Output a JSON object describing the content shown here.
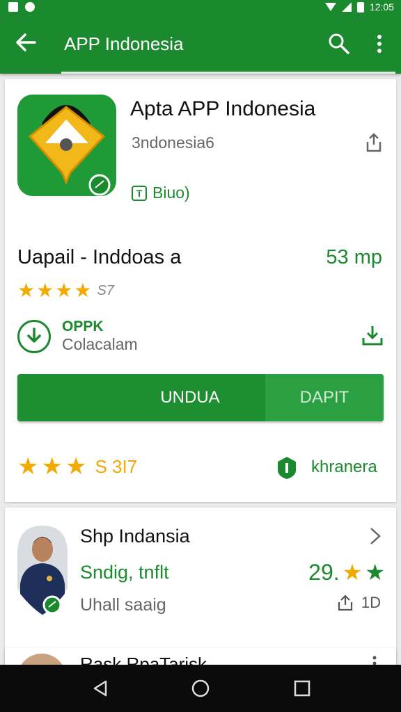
{
  "status_bar": {
    "time": "12:05"
  },
  "app_bar": {
    "title": "APP Indonesia"
  },
  "app_card": {
    "title": "Apta APP Indonesia",
    "developer": "3ndonesia6",
    "badge_label": "Biuo)",
    "subtitle": "Uapail - Inddoas a",
    "size": "53 mp",
    "rating_text_small": "S7",
    "download_label_top": "OPPK",
    "download_label_bottom": "Colacalam",
    "install_button": "UNDUA",
    "secondary_button": "DAPIT",
    "rating_text_large": "S 3I7",
    "shield_label": "khranera",
    "colors": {
      "brand": "#1b8a2e",
      "star": "#f2a900"
    }
  },
  "related": [
    {
      "title": "Shp Indansia",
      "subtitle": "Sndig, tnflt",
      "meta": "Uhall saaig",
      "rating_value": "29.",
      "action_label": "1D"
    },
    {
      "title": "Rask RpaTarisk"
    }
  ]
}
